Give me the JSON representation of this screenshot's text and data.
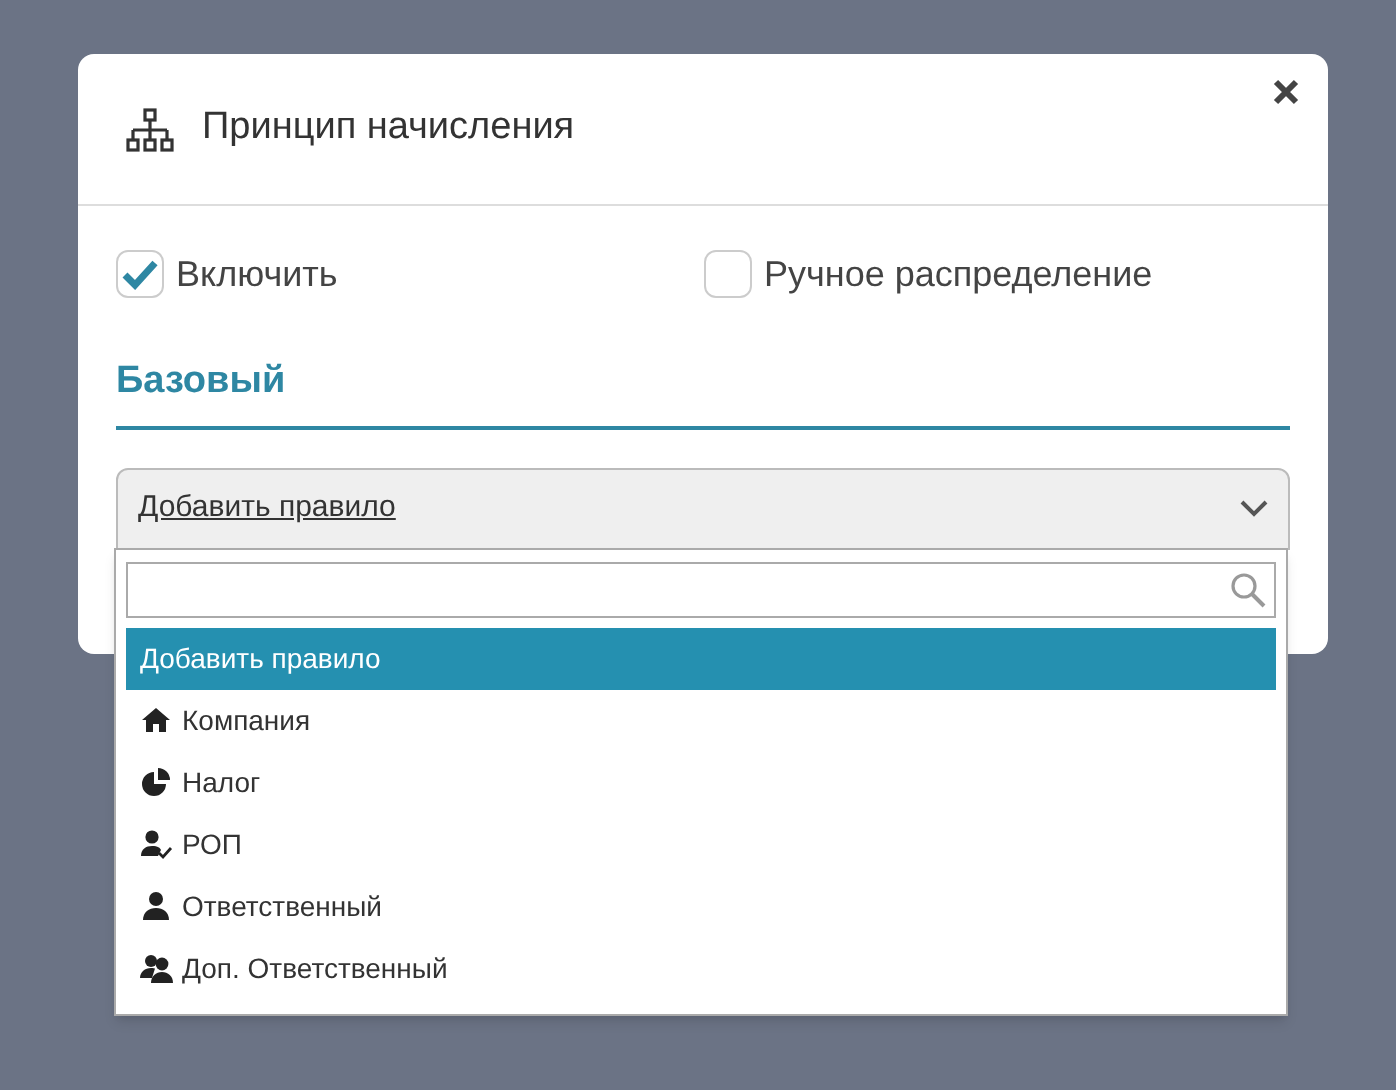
{
  "dialog": {
    "title": "Принцип начисления"
  },
  "checkboxes": [
    {
      "label": "Включить",
      "checked": true
    },
    {
      "label": "Ручное распределение",
      "checked": false
    }
  ],
  "section": {
    "title": "Базовый"
  },
  "select": {
    "value": "Добавить правило",
    "expanded": true
  },
  "dropdown": {
    "options": [
      {
        "label": "Добавить правило",
        "kind": "none",
        "selected": true
      },
      {
        "label": "Компания",
        "kind": "house",
        "selected": false
      },
      {
        "label": "Налог",
        "kind": "pie",
        "selected": false
      },
      {
        "label": "РОП",
        "kind": "user-check",
        "selected": false
      },
      {
        "label": "Ответственный",
        "kind": "user",
        "selected": false
      },
      {
        "label": "Доп. Ответственный",
        "kind": "users",
        "selected": false
      }
    ]
  }
}
